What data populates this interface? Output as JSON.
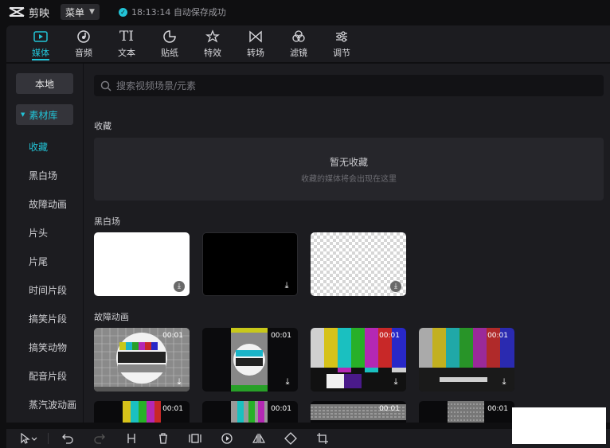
{
  "app": {
    "name": "剪映",
    "menu_label": "菜单",
    "save_status": "18:13:14 自动保存成功"
  },
  "toolbar": {
    "tabs": [
      {
        "label": "媒体",
        "icon": "media-icon"
      },
      {
        "label": "音频",
        "icon": "audio-icon"
      },
      {
        "label": "文本",
        "icon": "text-icon"
      },
      {
        "label": "贴纸",
        "icon": "sticker-icon"
      },
      {
        "label": "特效",
        "icon": "effects-icon"
      },
      {
        "label": "转场",
        "icon": "transition-icon"
      },
      {
        "label": "滤镜",
        "icon": "filter-icon"
      },
      {
        "label": "调节",
        "icon": "adjust-icon"
      }
    ],
    "active": "媒体"
  },
  "sidebar": {
    "local": "本地",
    "library": "素材库",
    "items": [
      "收藏",
      "黑白场",
      "故障动画",
      "片头",
      "片尾",
      "时间片段",
      "搞笑片段",
      "搞笑动物",
      "配音片段",
      "蒸汽波动画"
    ],
    "active": "收藏"
  },
  "search": {
    "placeholder": "搜索视频场景/元素"
  },
  "sections": {
    "favorites": {
      "title": "收藏",
      "empty_title": "暂无收藏",
      "empty_sub": "收藏的媒体将会出现在这里"
    },
    "black_white": {
      "title": "黑白场"
    },
    "glitch": {
      "title": "故障动画",
      "durations": [
        "00:01",
        "00:01",
        "00:01",
        "00:01",
        "00:01",
        "00:01",
        "00:01",
        "00:01"
      ]
    }
  },
  "colors": {
    "accent": "#22c3d6",
    "panel": "#1c1c20",
    "background": "#0f0f11"
  }
}
